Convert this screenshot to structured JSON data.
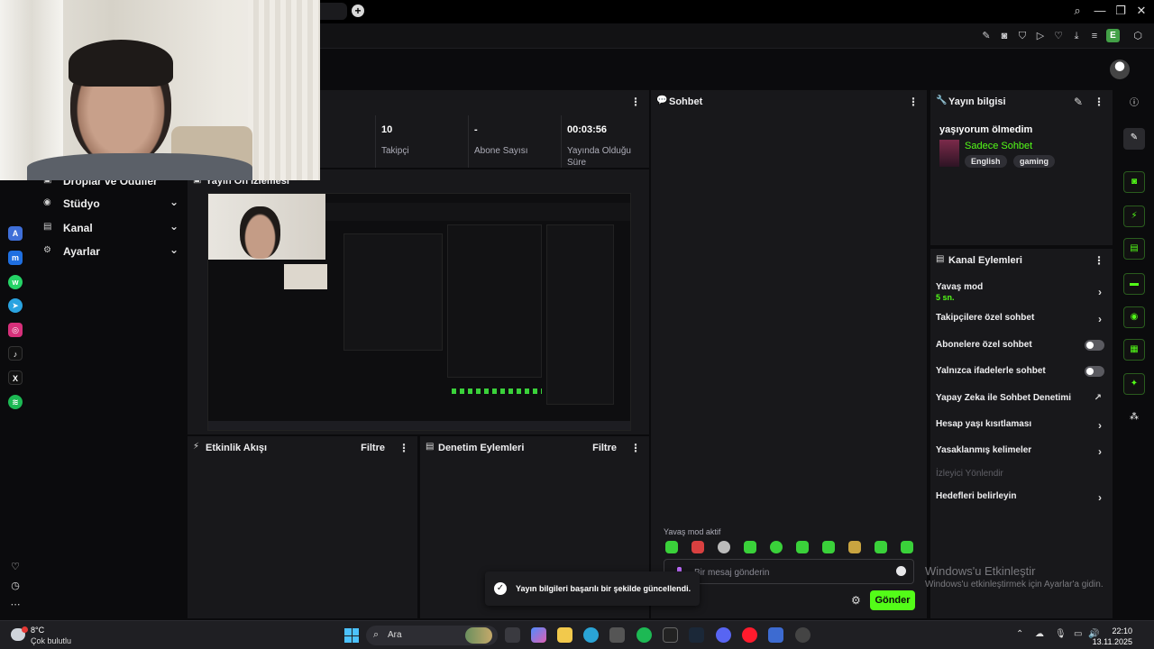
{
  "browser": {
    "window_controls": [
      "⌕",
      "—",
      "❐",
      "✕"
    ],
    "profile_letter": "E"
  },
  "leftnav": {
    "partial_item": "Droplar ve Ödüller",
    "items": [
      {
        "label": "Stüdyo"
      },
      {
        "label": "Kanal"
      },
      {
        "label": "Ayarlar"
      }
    ]
  },
  "stats": [
    {
      "value": "10",
      "label": "Takipçi"
    },
    {
      "value": "-",
      "label": "Abone Sayısı"
    },
    {
      "value": "00:03:56",
      "label": "Yayında Olduğu Süre"
    }
  ],
  "preview": {
    "title": "Yayın Ön İzlemesi"
  },
  "activity": {
    "title": "Etkinlik Akışı",
    "filter": "Filtre"
  },
  "moderation": {
    "title": "Denetim Eylemleri",
    "filter": "Filtre"
  },
  "chat": {
    "title": "Sohbet",
    "slow_mode": "Yavaş mod aktif",
    "placeholder": "Bir mesaj gönderin",
    "send": "Gönder"
  },
  "stream_info": {
    "title": "Yayın bilgisi",
    "stream_title": "yaşıyorum ölmedim",
    "category": "Sadece Sohbet",
    "tags": [
      "English",
      "gaming"
    ]
  },
  "channel_actions": {
    "title": "Kanal Eylemleri",
    "slow_mode": {
      "label": "Yavaş mod",
      "sub": "5 sn."
    },
    "followers_only": "Takipçilere özel sohbet",
    "subscribers_only": "Abonelere özel sohbet",
    "emotes_only": "Yalnızca ifadelerle sohbet",
    "ai_moderation": "Yapay Zeka ile Sohbet Denetimi",
    "account_age": "Hesap yaşı kısıtlaması",
    "banned_words": "Yasaklanmış kelimeler",
    "redirect_viewers": "İzleyici Yönlendir",
    "set_goals": "Hedefleri belirleyin"
  },
  "toast": {
    "message": "Yayın bilgileri başarılı bir şekilde güncellendi."
  },
  "watermark": {
    "line1": "Windows'u Etkinleştir",
    "line2": "Windows'u etkinleştirmek için Ayarlar'a gidin."
  },
  "taskbar": {
    "temperature": "8°C",
    "weather": "Çok bulutlu",
    "search": "Ara",
    "time": "22:10",
    "date": "13.11.2025"
  },
  "colors": {
    "accent": "#53fc18",
    "panel": "#18181b",
    "background": "#0b0b0d"
  }
}
